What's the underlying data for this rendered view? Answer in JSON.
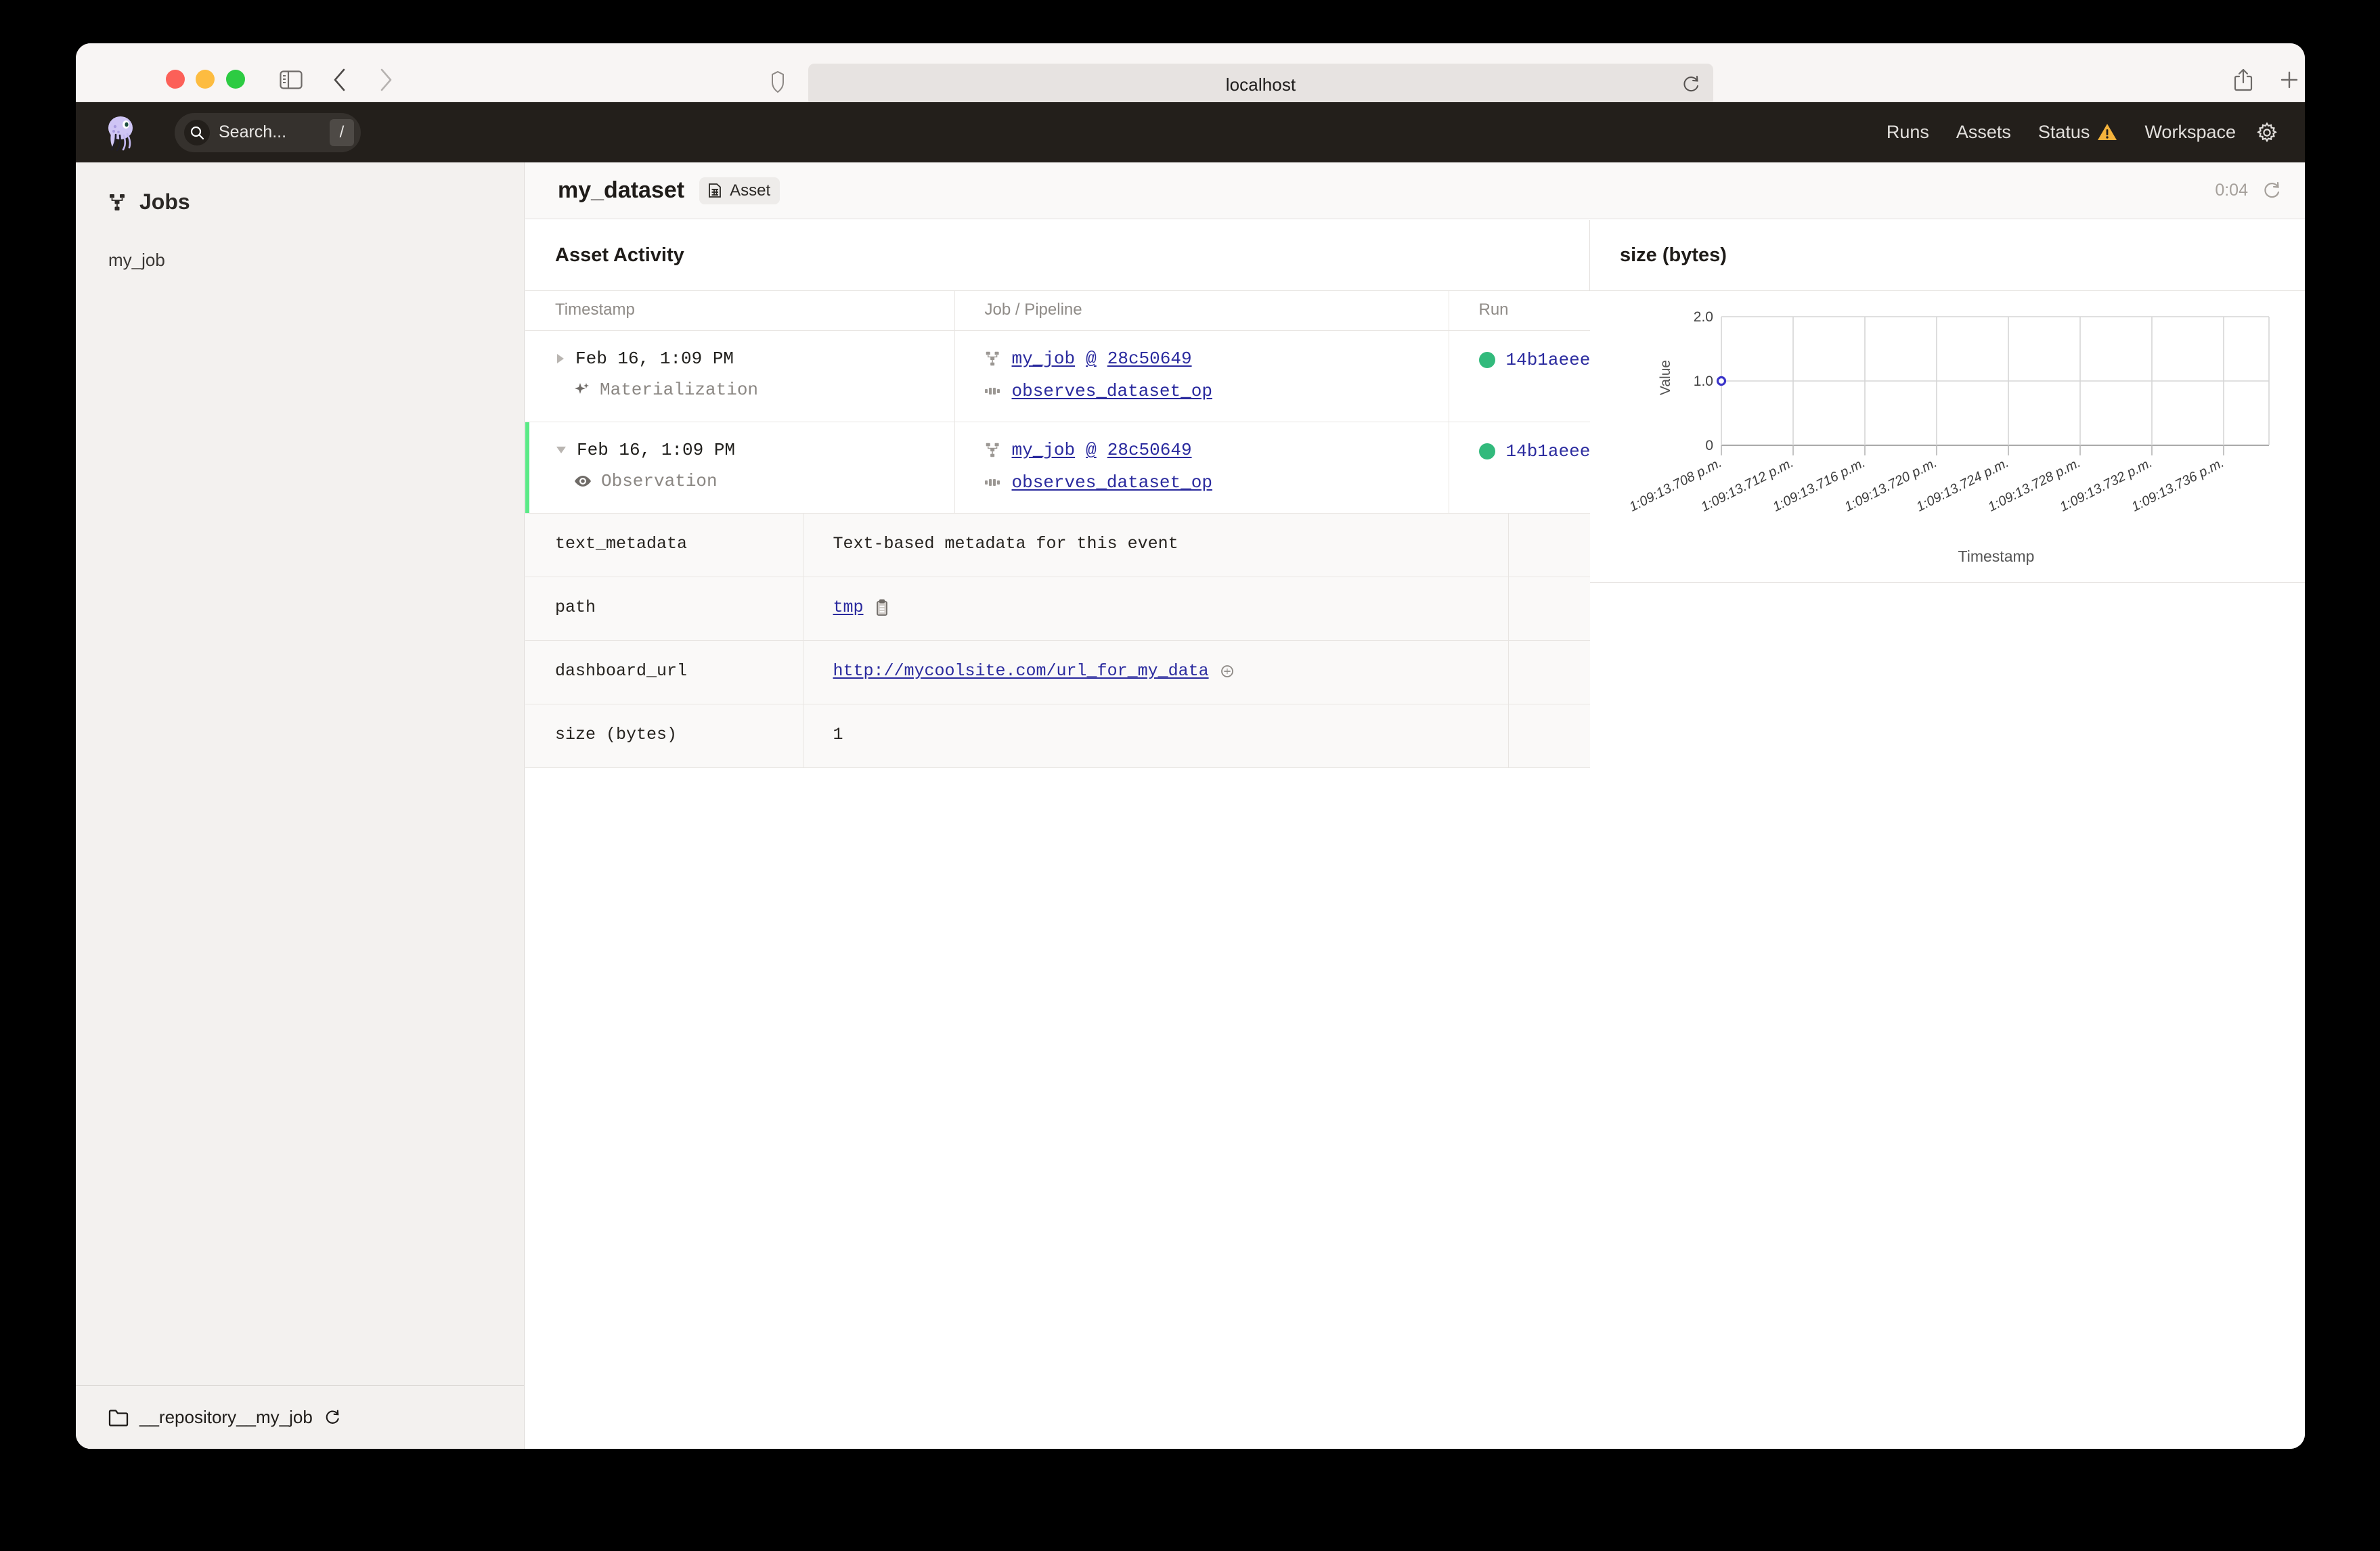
{
  "browser": {
    "url": "localhost",
    "traffic_lights": [
      "close-red",
      "minimize-yellow",
      "zoom-green"
    ],
    "icons": {
      "sidebar": "sidebar-toggle-icon",
      "back": "nav-back-icon",
      "forward": "nav-forward-icon",
      "shield": "shield-icon",
      "reload": "reload-icon",
      "share": "share-icon",
      "new_tab": "newtab-icon",
      "tabs": "tabs-icon"
    }
  },
  "app_header": {
    "logo": "dagster-octopus-logo",
    "search_placeholder": "Search...",
    "search_shortcut": "/",
    "nav": [
      {
        "label": "Runs",
        "warning": false
      },
      {
        "label": "Assets",
        "warning": false
      },
      {
        "label": "Status",
        "warning": true
      },
      {
        "label": "Workspace",
        "warning": false
      }
    ],
    "settings_icon": "gear-icon"
  },
  "sidebar": {
    "section_title": "Jobs",
    "section_icon": "job-graph-icon",
    "items": [
      {
        "label": "my_job"
      }
    ],
    "footer": {
      "icon": "folder-icon",
      "label": "__repository__my_job",
      "reload_icon": "reload-icon"
    }
  },
  "content_header": {
    "title": "my_dataset",
    "badge_label": "Asset",
    "badge_icon": "asset-table-icon",
    "refresh_timer": "0:04",
    "refresh_icon": "refresh-icon"
  },
  "activity": {
    "heading": "Asset Activity",
    "columns": [
      "Timestamp",
      "Job / Pipeline",
      "Run"
    ],
    "rows": [
      {
        "expanded": false,
        "selected": false,
        "disclosure": "chevron-right-icon",
        "timestamp": "Feb 16, 1:09 PM",
        "event_type": "Materialization",
        "event_icon": "materialization-icon",
        "job": "my_job",
        "job_sep": "@",
        "job_snapshot": "28c50649",
        "op": "observes_dataset_op",
        "run_id": "14b1aeee",
        "run_status_color": "#32ba7c"
      },
      {
        "expanded": true,
        "selected": true,
        "disclosure": "chevron-down-icon",
        "timestamp": "Feb 16, 1:09 PM",
        "event_type": "Observation",
        "event_icon": "observation-eye-icon",
        "job": "my_job",
        "job_sep": "@",
        "job_snapshot": "28c50649",
        "op": "observes_dataset_op",
        "run_id": "14b1aeee",
        "run_status_color": "#32ba7c"
      }
    ],
    "metadata": [
      {
        "key": "text_metadata",
        "value": "Text-based metadata for this event",
        "kind": "text",
        "icon": null
      },
      {
        "key": "path",
        "value": "tmp",
        "kind": "link",
        "icon": "copy-icon"
      },
      {
        "key": "dashboard_url",
        "value": "http://mycoolsite.com/url_for_my_data",
        "kind": "link",
        "icon": "external-link-icon"
      },
      {
        "key": "size (bytes)",
        "value": "1",
        "kind": "text",
        "icon": null
      }
    ]
  },
  "chart_panel": {
    "heading": "size (bytes)"
  },
  "chart_data": {
    "type": "scatter",
    "title": "size (bytes)",
    "xlabel": "Timestamp",
    "ylabel": "Value",
    "ylim": [
      0,
      2.0
    ],
    "yticks": [
      "0",
      "1.0",
      "2.0"
    ],
    "ytick_values": [
      0,
      1.0,
      2.0
    ],
    "grid": true,
    "legend": false,
    "xticks": [
      "1:09:13.708 p.m.",
      "1:09:13.712 p.m.",
      "1:09:13.716 p.m.",
      "1:09:13.720 p.m.",
      "1:09:13.724 p.m.",
      "1:09:13.728 p.m.",
      "1:09:13.732 p.m.",
      "1:09:13.736 p.m."
    ],
    "series": [
      {
        "name": "size (bytes)",
        "color": "#3b35c9",
        "points": [
          {
            "x": "1:09:13.708 p.m.",
            "y": 1.0
          }
        ]
      }
    ]
  },
  "colors": {
    "app_header_bg": "#231f1b",
    "accent_green": "#5bea87",
    "link_blue": "#2a2a9e",
    "status_green": "#32ba7c",
    "warning_amber": "#f5b33c",
    "point_blue": "#3b35c9"
  }
}
